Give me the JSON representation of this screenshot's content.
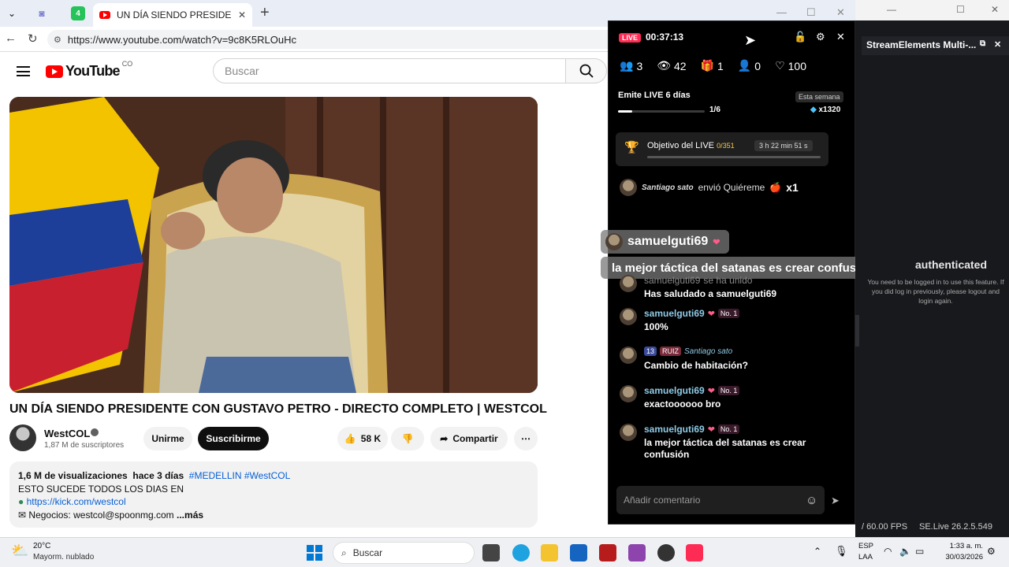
{
  "browser": {
    "active_tab_title": "UN DÍA SIENDO PRESIDENTE CON",
    "url": "https://www.youtube.com/watch?v=9c8K5RLOuHc",
    "badge_count": "4"
  },
  "youtube": {
    "logo_text": "YouTube",
    "country_code": "CO",
    "search_placeholder": "Buscar",
    "video_title": "UN DÍA SIENDO PRESIDENTE CON GUSTAVO PETRO - DIRECTO COMPLETO | WESTCOL",
    "channel": {
      "name": "WestCOL",
      "subscribers": "1,87 M de suscriptores",
      "join_label": "Unirme",
      "subscribe_label": "Suscribirme"
    },
    "actions": {
      "likes": "58 K",
      "share_label": "Compartir"
    },
    "description": {
      "views": "1,6 M de visualizaciones",
      "age": "hace 3 días",
      "tags": "#MEDELLIN #WestCOL",
      "line1": "ESTO SUCEDE TODOS LOS DIAS EN",
      "link": "https://kick.com/westcol",
      "business": "Negocios: westcol@spoonmg.com",
      "more": "...más"
    }
  },
  "live": {
    "badge": "LIVE",
    "elapsed": "00:37:13",
    "stats": {
      "viewers_group": "3",
      "views": "42",
      "gifts": "1",
      "new_followers": "0",
      "likes": "100"
    },
    "streak": {
      "label": "Emite LIVE 6 días",
      "week_label": "Esta semana",
      "progress_text": "1/6",
      "progress_value": 0.1667,
      "multiplier": "x1320"
    },
    "goal": {
      "title": "Objetivo del LIVE",
      "count": "0/351",
      "timer": "3 h 22 min 51 s"
    },
    "gift_event": {
      "sender": "Santiago sato",
      "action": "envió Quiéreme",
      "count": "x1"
    },
    "overlay": {
      "user": "samuelguti69",
      "message": "la mejor táctica del satanas es crear confusión"
    },
    "messages": [
      {
        "user": "samuelguti69",
        "meta": "se ha unido",
        "text": "Has saludado a samuelguti69"
      },
      {
        "user": "samuelguti69",
        "badge": "No. 1",
        "text": "100%"
      },
      {
        "level": "13",
        "fan": "RUIZ",
        "user": "Santiago sato",
        "text": "Cambio de habitación?"
      },
      {
        "user": "samuelguti69",
        "badge": "No. 1",
        "text": "exactoooooo bro"
      },
      {
        "user": "samuelguti69",
        "badge": "No. 1",
        "text": "la mejor táctica del satanas es crear confusión"
      }
    ],
    "comment_placeholder": "Añadir comentario"
  },
  "streamelements": {
    "header": "StreamElements Multi-...",
    "auth_title": "authenticated",
    "auth_text": "You need to be logged in to use this feature. If you did log in previously, please logout and login again.",
    "fps": "/ 60.00 FPS",
    "version": "SE.Live 26.2.5.549"
  },
  "taskbar": {
    "temperature": "20°C",
    "weather": "Mayorm. nublado",
    "search_label": "Buscar",
    "lang_line1": "ESP",
    "lang_line2": "LAA",
    "time": "1:33 a. m.",
    "date": "30/03/2026"
  }
}
